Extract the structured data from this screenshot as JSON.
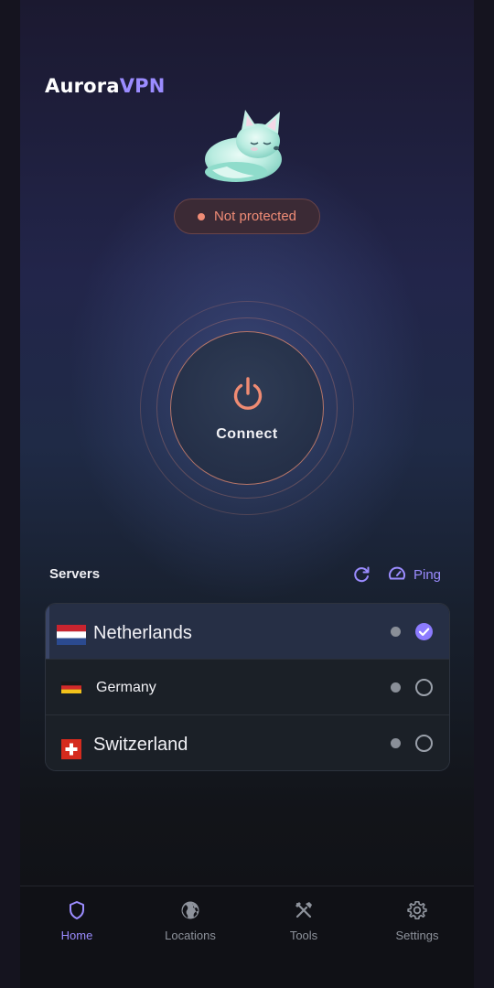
{
  "app": {
    "brand_main": "Aurora",
    "brand_accent": "VPN"
  },
  "status": {
    "label": "Not protected",
    "color": "#f08c76"
  },
  "power": {
    "label": "Connect"
  },
  "servers": {
    "title": "Servers",
    "ping_label": "Ping",
    "items": [
      {
        "name": "Netherlands",
        "flag": "netherlands-flag",
        "selected": true
      },
      {
        "name": "Germany",
        "flag": "germany-flag",
        "selected": false
      },
      {
        "name": "Switzerland",
        "flag": "switzerland-flag",
        "selected": false
      }
    ]
  },
  "nav": {
    "items": [
      {
        "label": "Home",
        "icon": "shield-icon",
        "active": true
      },
      {
        "label": "Locations",
        "icon": "globe-icon",
        "active": false
      },
      {
        "label": "Tools",
        "icon": "tools-icon",
        "active": false
      },
      {
        "label": "Settings",
        "icon": "gear-icon",
        "active": false
      }
    ]
  },
  "colors": {
    "accent": "#9b8cff",
    "warning": "#f08c76",
    "background": "#15141f"
  }
}
